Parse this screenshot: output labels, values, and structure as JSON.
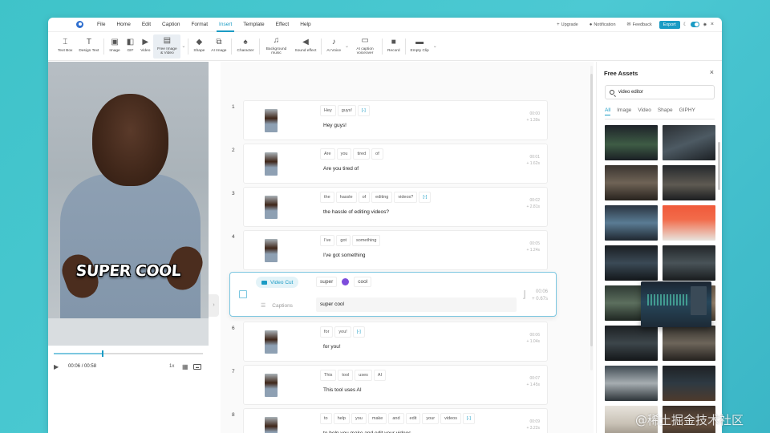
{
  "menu": {
    "items": [
      "File",
      "Home",
      "Edit",
      "Caption",
      "Format",
      "Insert",
      "Template",
      "Effect",
      "Help"
    ],
    "active": "Insert",
    "upgrade": "Upgrade",
    "notification": "Notification",
    "feedback": "Feedback",
    "export": "Export"
  },
  "toolbar": {
    "text_box": "Text Box",
    "design_text": "Design Text",
    "image": "Image",
    "gif": "GIF",
    "video": "Video",
    "free_image_video": "Free Image & Video",
    "shape": "Shape",
    "ai_image": "AI Image",
    "character": "Character",
    "background_music": "Background music",
    "sound_effect": "Sound effect",
    "ai_voice": "AI Voice",
    "ai_caption_voiceover": "AI caption voiceover",
    "record": "Record",
    "empty_clip": "Empty Clip"
  },
  "preview": {
    "overlay_text": "SUPER COOL",
    "current_time": "00:06",
    "total_time": "/ 00:58",
    "speed": "1x",
    "progress": 0.32
  },
  "scenes": [
    {
      "num": "1",
      "words": [
        "Hey",
        "guys!",
        "[-]"
      ],
      "caption": "Hey guys!",
      "meta_time": "00:00",
      "meta_len": "+ 1.39s"
    },
    {
      "num": "2",
      "words": [
        "Are",
        "you",
        "tired",
        "of"
      ],
      "caption": "Are you tired of",
      "meta_time": "00:01",
      "meta_len": "+ 1.62s"
    },
    {
      "num": "3",
      "words": [
        "the",
        "hassle",
        "of",
        "editing",
        "videos?",
        "[-]"
      ],
      "caption": "the hassle of editing videos?",
      "meta_time": "00:02",
      "meta_len": "+ 2.81s"
    },
    {
      "num": "4",
      "words": [
        "I've",
        "got",
        "something"
      ],
      "caption": "I've got something",
      "meta_time": "00:05",
      "meta_len": "+ 1.24s"
    },
    {
      "num": "6",
      "words": [
        "for",
        "you!",
        "[-]"
      ],
      "caption": "for you!",
      "meta_time": "00:06",
      "meta_len": "+ 1.04s"
    },
    {
      "num": "7",
      "words": [
        "This",
        "tool",
        "uses",
        "AI"
      ],
      "caption": "This tool uses AI",
      "meta_time": "00:07",
      "meta_len": "+ 1.45s"
    },
    {
      "num": "8",
      "words": [
        "to",
        "help",
        "you",
        "make",
        "and",
        "edit",
        "your",
        "videos",
        "[-]"
      ],
      "caption": "to help you make and edit your videos",
      "meta_time": "00:09",
      "meta_len": "+ 3.22s"
    }
  ],
  "expanded_scene": {
    "video_cut_label": "Video Cut",
    "captions_label": "Captions",
    "word1": "super",
    "word2": "cool",
    "caption_value": "super cool",
    "meta_time": "00:06",
    "meta_len": "+ 0.67s"
  },
  "assets": {
    "title": "Free Assets",
    "search_value": "video editor",
    "tabs": [
      "All",
      "Image",
      "Video",
      "Shape",
      "GIPHY"
    ],
    "active_tab": "All"
  },
  "watermark": "@稀土掘金技术社区"
}
